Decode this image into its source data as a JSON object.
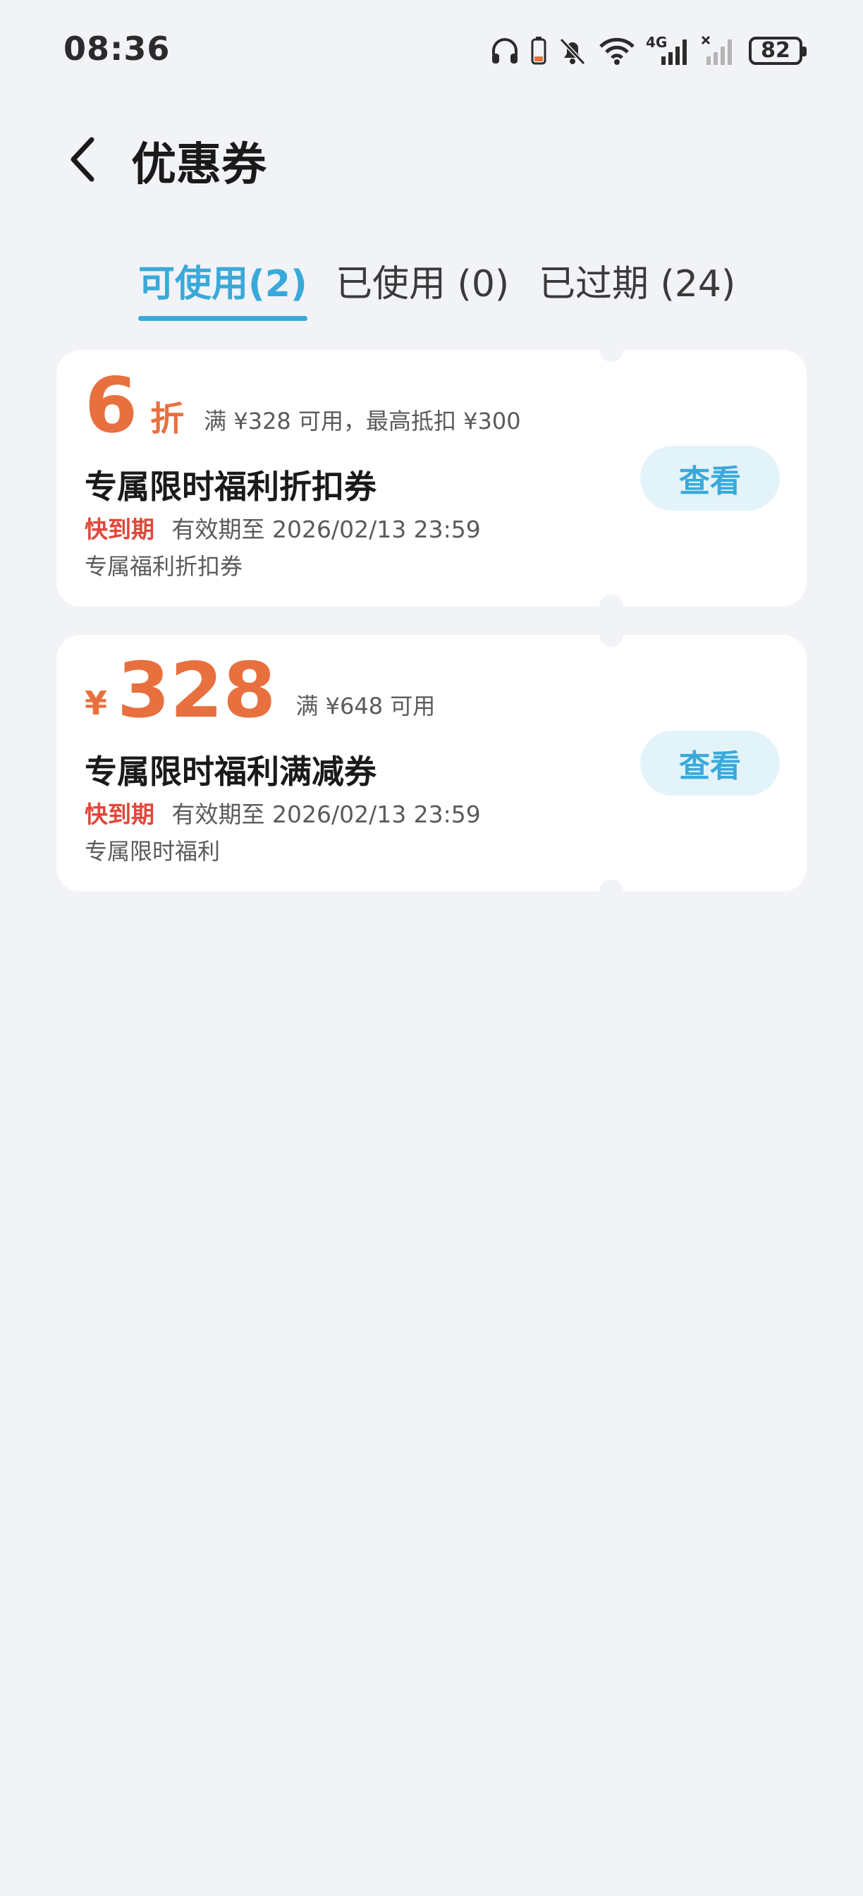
{
  "status_bar": {
    "time": "08:36",
    "network": "4G",
    "battery": "82",
    "icons": [
      "headphones-icon",
      "phone-battery-icon",
      "bell-mute-icon",
      "wifi-icon",
      "signal-4g-icon",
      "signal-no-sim-icon",
      "battery-icon"
    ]
  },
  "header": {
    "back_icon": "chevron-left-icon",
    "title": "优惠券"
  },
  "tabs": [
    {
      "label": "可使用(2)",
      "active": true
    },
    {
      "label": "已使用 (0)",
      "active": false
    },
    {
      "label": "已过期 (24)",
      "active": false
    }
  ],
  "coupons": [
    {
      "value": "6",
      "unit": "折",
      "condition": "满 ¥328 可用，最高抵扣 ¥300",
      "name": "专属限时福利折扣券",
      "expiring_label": "快到期",
      "valid_until": "有效期至 2026/02/13 23:59",
      "description": "专属福利折扣券",
      "button": "查看"
    },
    {
      "currency": "¥",
      "value": "328",
      "condition": "满 ¥648 可用",
      "name": "专属限时福利满减券",
      "expiring_label": "快到期",
      "valid_until": "有效期至 2026/02/13 23:59",
      "description": "专属限时福利",
      "button": "查看"
    }
  ],
  "colors": {
    "accent": "#3aa9d9",
    "value": "#e8703f",
    "warning": "#e0473a",
    "background": "#f1f3f7"
  }
}
